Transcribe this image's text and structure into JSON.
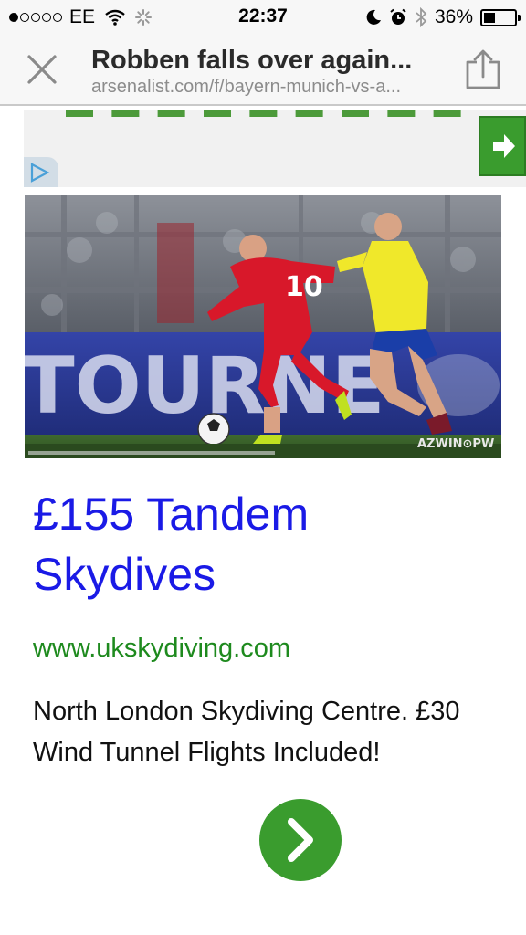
{
  "status_bar": {
    "carrier": "EE",
    "signal_bars_filled": 1,
    "signal_bars_total": 5,
    "time": "22:37",
    "battery_percent": "36%",
    "battery_level": 0.36
  },
  "browser": {
    "page_title": "Robben falls over again...",
    "url": "arsenalist.com/f/bayern-munich-vs-a...",
    "close_icon": "close-icon",
    "share_icon": "share-icon"
  },
  "ad_banner": {
    "adchoices_icon": "adchoices-icon",
    "arrow_icon": "arrow-right-icon"
  },
  "media": {
    "board_text": "TOURNE",
    "player_number": "10",
    "watermark": "AZWIN⊙PW"
  },
  "ad": {
    "headline": "£155 Tandem Skydives",
    "display_url": "www.ukskydiving.com",
    "description": "North London Skydiving Centre. £30 Wind Tunnel Flights Included!",
    "go_icon": "chevron-right-icon"
  },
  "colors": {
    "headline": "#1a1ae6",
    "url_green": "#1e8a1e",
    "button_green": "#3a9c2e"
  }
}
